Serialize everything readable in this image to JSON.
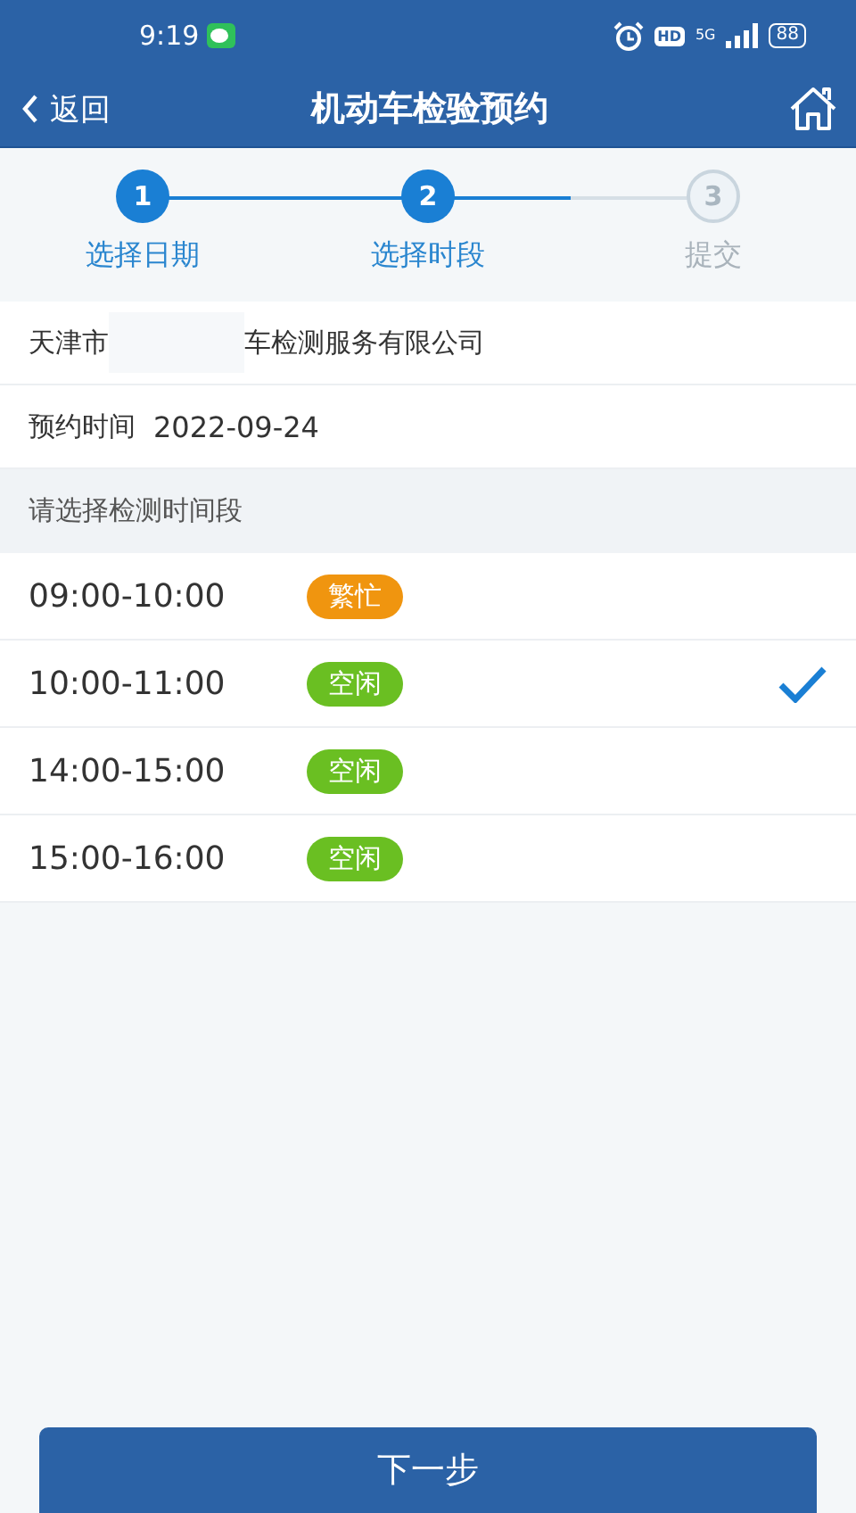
{
  "status_bar": {
    "time": "9:19",
    "network": "5G",
    "battery": "88",
    "hd": "HD"
  },
  "header": {
    "back": "返回",
    "title": "机动车检验预约"
  },
  "steps": [
    {
      "number": "1",
      "label": "选择日期",
      "reached": true
    },
    {
      "number": "2",
      "label": "选择时段",
      "reached": true
    },
    {
      "number": "3",
      "label": "提交",
      "reached": false
    }
  ],
  "company": {
    "prefix": "天津市",
    "suffix": "车检测服务有限公司"
  },
  "appointment": {
    "label": "预约时间",
    "date": "2022-09-24"
  },
  "section_title": "请选择检测时间段",
  "slots": [
    {
      "time": "09:00-10:00",
      "status": "繁忙",
      "kind": "busy",
      "selected": false
    },
    {
      "time": "10:00-11:00",
      "status": "空闲",
      "kind": "free",
      "selected": true
    },
    {
      "time": "14:00-15:00",
      "status": "空闲",
      "kind": "free",
      "selected": false
    },
    {
      "time": "15:00-16:00",
      "status": "空闲",
      "kind": "free",
      "selected": false
    }
  ],
  "next_button": "下一步"
}
